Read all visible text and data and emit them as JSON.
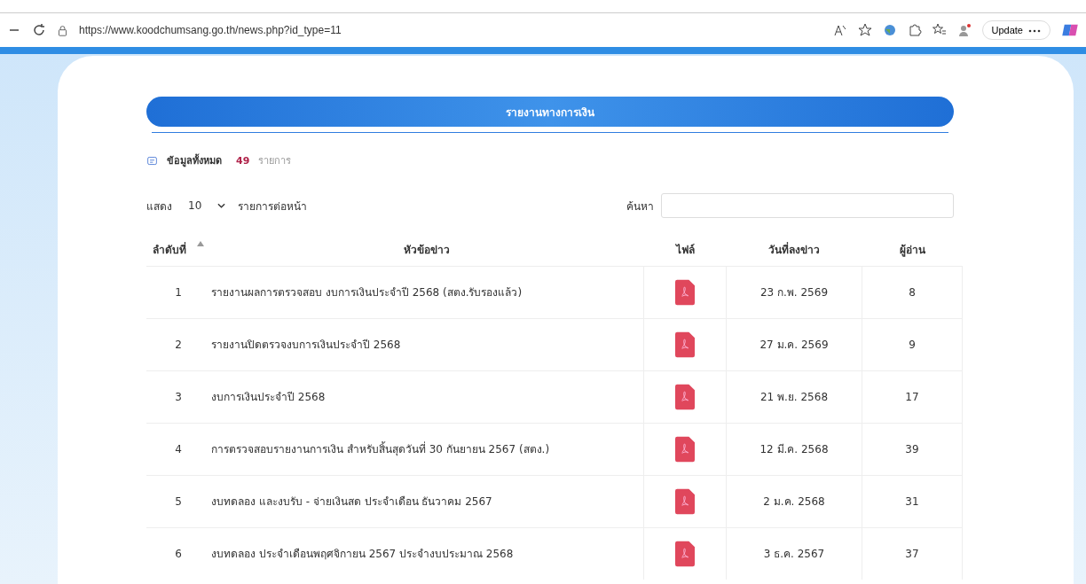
{
  "browser": {
    "url": "https://www.koodchumsang.go.th/news.php?id_type=11",
    "update_label": "Update"
  },
  "heading": "รายงานทางการเงิน",
  "summary": {
    "label": "ข้อมูลทั้งหมด",
    "count": "49",
    "unit": "รายการ"
  },
  "length": {
    "prefix": "แสดง",
    "value": "10",
    "suffix": "รายการต่อหน้า"
  },
  "search": {
    "label": "ค้นหา"
  },
  "table": {
    "columns": [
      {
        "label": "ลำดับที่",
        "sorted": true
      },
      {
        "label": "หัวข้อข่าว",
        "sorted": false
      },
      {
        "label": "ไฟล์",
        "sorted": false
      },
      {
        "label": "วันที่ลงข่าว",
        "sorted": false
      },
      {
        "label": "ผู้อ่าน",
        "sorted": false
      }
    ],
    "rows": [
      {
        "no": "1",
        "title": "รายงานผลการตรวจสอบ งบการเงินประจำปี 2568 (สตง.รับรองแล้ว)",
        "date": "23 ก.พ. 2569",
        "reads": "8"
      },
      {
        "no": "2",
        "title": "รายงานปิดตรวจงบการเงินประจำปี 2568",
        "date": "27 ม.ค. 2569",
        "reads": "9"
      },
      {
        "no": "3",
        "title": "งบการเงินประจำปี 2568",
        "date": "21 พ.ย. 2568",
        "reads": "17"
      },
      {
        "no": "4",
        "title": "การตรวจสอบรายงานการเงิน สำหรับสิ้นสุดวันที่ 30 กันยายน 2567 (สตง.)",
        "date": "12 มี.ค. 2568",
        "reads": "39"
      },
      {
        "no": "5",
        "title": "งบทดลอง และงบรับ - จ่ายเงินสด ประจำเดือน ธันวาคม 2567",
        "date": "2 ม.ค. 2568",
        "reads": "31"
      },
      {
        "no": "6",
        "title": "งบทดลอง ประจำเดือนพฤศจิกายน 2567 ประจำงบประมาณ 2568",
        "date": "3 ธ.ค. 2567",
        "reads": "37"
      }
    ]
  }
}
